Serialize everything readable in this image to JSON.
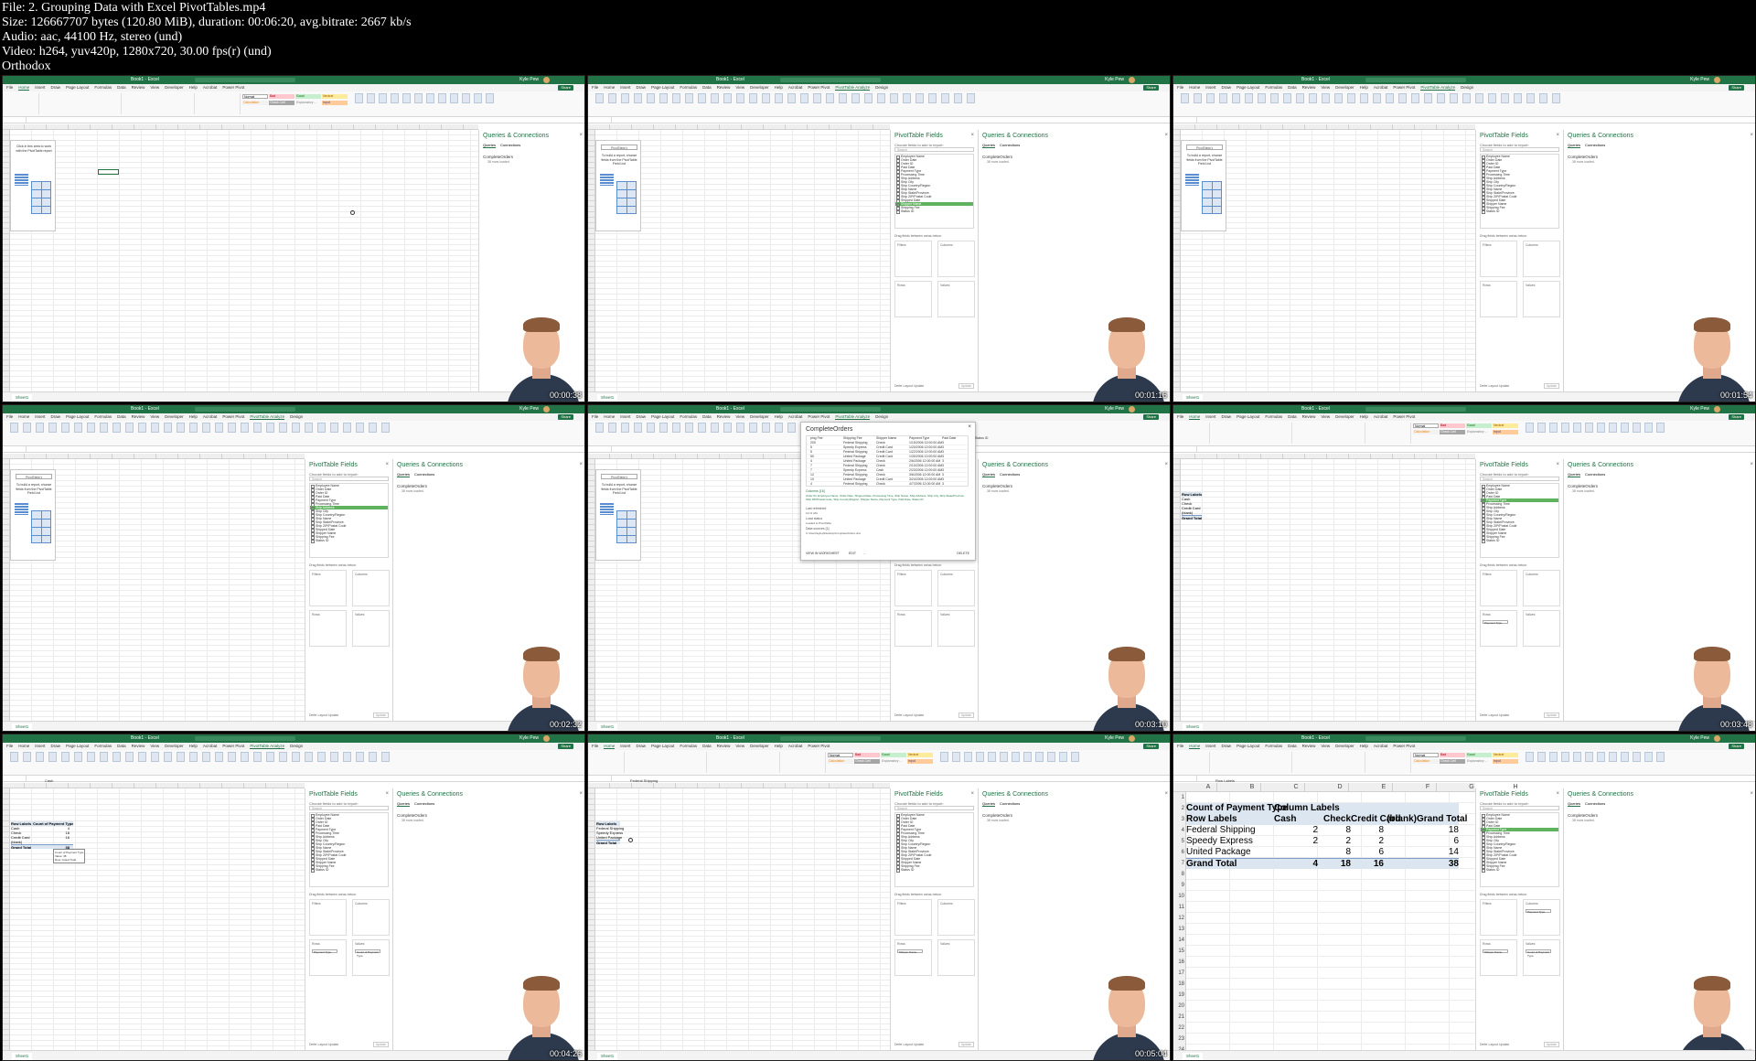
{
  "header": {
    "file": "File: 2. Grouping Data with Excel PivotTables.mp4",
    "size": "Size: 126667707 bytes (120.80 MiB), duration: 00:06:20, avg.bitrate: 2667 kb/s",
    "audio": "Audio: aac, 44100 Hz, stereo (und)",
    "video": "Video: h264, yuv420p, 1280x720, 30.00 fps(r) (und)",
    "brand": "Orthodox"
  },
  "excel": {
    "title": "Book1 - Excel",
    "user": "Kyle Pew",
    "share": "Share",
    "comments": "Comments",
    "sheet": "Sheet1",
    "tabs": [
      "File",
      "Home",
      "Insert",
      "Draw",
      "Page Layout",
      "Formulas",
      "Data",
      "Review",
      "View",
      "Developer",
      "Help",
      "Acrobat",
      "Power Pivot",
      "PivotTable Analyze",
      "Design"
    ],
    "styles": {
      "normal": "Normal",
      "bad": "Bad",
      "good": "Good",
      "neutral": "Neutral",
      "calculation": "Calculation",
      "check": "Check Cell",
      "explanatory": "Explanatory ...",
      "input": "Input"
    },
    "placeholder": {
      "title": "PivotTable1",
      "text": "To build a report, choose fields from the PivotTable Field List"
    },
    "placeholder_first": "Click in this area to work with the PivotTable report",
    "fields_pane": {
      "title": "PivotTable Fields",
      "subtitle": "Choose fields to add to report:",
      "search": "Search",
      "fields": [
        "Employee Name",
        "Order Date",
        "Order ID",
        "Paid Date",
        "Payment Type",
        "Processing Time",
        "Ship Address",
        "Ship City",
        "Ship Country/Region",
        "Ship Name",
        "Ship State/Province",
        "Ship ZIP/Postal Code",
        "Shipped Date",
        "Shipper Name",
        "Shipping Fee",
        "Status ID"
      ],
      "drag_label": "Drag fields between areas below:",
      "filters": "Filters",
      "columns": "Columns",
      "rows": "Rows",
      "values": "Values",
      "defer": "Defer Layout Update",
      "update": "Update"
    },
    "queries_pane": {
      "title": "Queries & Connections",
      "tab_queries": "Queries",
      "tab_connections": "Connections",
      "item": "CompleteOrders",
      "item_sub": "38 rows loaded."
    },
    "dialog": {
      "title": "CompleteOrders",
      "columns": [
        "ping Fee",
        "Shipping Fee",
        "Shipper Name",
        "Payment Type",
        "Paid Date",
        "Status ID"
      ],
      "rows": [
        [
          "200",
          "Federal Shipping",
          "Check",
          "1/15/2006 12:00:00 AM",
          "3"
        ],
        [
          "5",
          "Speedy Express",
          "Credit Card",
          "1/20/2006 12:00:00 AM",
          "3"
        ],
        [
          "5",
          "Federal Shipping",
          "Credit Card",
          "1/22/2006 12:00:00 AM",
          "3"
        ],
        [
          "50",
          "United Package",
          "Credit Card",
          "1/30/2006 12:00:00 AM",
          "3"
        ],
        [
          "4",
          "United Package",
          "Check",
          "2/6/2006 12:00:00 AM",
          "3"
        ],
        [
          "7",
          "Federal Shipping",
          "Check",
          "2/10/2006 12:00:00 AM",
          "3"
        ],
        [
          "7",
          "Speedy Express",
          "Cash",
          "2/23/2006 12:00:00 AM",
          "3"
        ],
        [
          "12",
          "Federal Shipping",
          "Check",
          "3/6/2006 12:00:00 AM",
          "3"
        ],
        [
          "10",
          "United Package",
          "Credit Card",
          "3/24/2006 12:00:00 AM",
          "3"
        ],
        [
          "4",
          "Federal Shipping",
          "Check",
          "4/7/2006 12:00:00 AM",
          "3"
        ]
      ],
      "columns_label": "Columns [16]",
      "columns_text": "Order ID, Employee Name, Order Date, Shipped Date, Processing Time, Ship Name, Ship Address, Ship City, Ship State/Province, Ship ZIP/Postal Code, Ship Country/Region, Shipper Name, Payment Type, Paid Date, Status ID",
      "last_refreshed_label": "Last refreshed",
      "last_refreshed": "12:11 AM",
      "load_status_label": "Load status",
      "load_status": "Loaded to PivotTable",
      "data_sources_label": "Data sources [1]",
      "data_source": "C:\\Users\\kylep\\Desktop\\CompleteOrders.xlsx",
      "view": "VIEW IN WORKSHEET",
      "edit": "EDIT",
      "more": "...",
      "delete": "DELETE"
    },
    "pivot_small": {
      "row_labels": "Row Labels",
      "items": [
        "Cash",
        "Check",
        "Credit Card",
        "(blank)"
      ],
      "grand_total": "Grand Total"
    },
    "pivot_count": {
      "row_labels": "Row Labels",
      "value_header": "Count of Payment Type",
      "items": [
        [
          "Cash",
          "4"
        ],
        [
          "Check",
          "18"
        ],
        [
          "Credit Card",
          "16"
        ],
        [
          "(blank)",
          ""
        ]
      ],
      "grand_total": [
        "Grand Total",
        "38"
      ],
      "tooltip": [
        "Count of Payment Type",
        "Value: 38",
        "Row: Grand Total"
      ],
      "formula": "Cash"
    },
    "pivot_shippers": {
      "row_labels": "Row Labels",
      "items": [
        "Federal Shipping",
        "Speedy Express",
        "United Package"
      ],
      "grand_total": "Grand Total",
      "formula": "Federal Shipping"
    },
    "pivot_final": {
      "formula": "Row Labels",
      "col_letters": [
        "A",
        "B",
        "C",
        "D",
        "E",
        "F",
        "G",
        "H"
      ],
      "row_numbers": [
        "1",
        "2",
        "3",
        "4",
        "5",
        "6",
        "7",
        "8",
        "9",
        "10",
        "11",
        "12",
        "13",
        "14",
        "15",
        "16",
        "17",
        "18",
        "19",
        "20",
        "21",
        "22",
        "23",
        "24",
        "25"
      ],
      "corner": "Count of Payment Type",
      "col_labels": "Column Labels",
      "row_labels": "Row Labels",
      "columns": [
        "Cash",
        "Check",
        "Credit Card",
        "(blank)",
        "Grand Total"
      ],
      "rows": [
        [
          "Federal Shipping",
          "2",
          "8",
          "8",
          "",
          "18"
        ],
        [
          "Speedy Express",
          "2",
          "2",
          "2",
          "",
          "6"
        ],
        [
          "United Package",
          "",
          "8",
          "6",
          "",
          "14"
        ],
        [
          "Grand Total",
          "4",
          "18",
          "16",
          "",
          "38"
        ]
      ],
      "rows_area": "Shipper Name",
      "columns_area": "Payment Type",
      "values_area": "Count of Payment Type"
    }
  },
  "frames": [
    {
      "time": "00:00:38"
    },
    {
      "time": "00:01:16"
    },
    {
      "time": "00:01:54"
    },
    {
      "time": "00:02:32"
    },
    {
      "time": "00:03:10"
    },
    {
      "time": "00:03:48"
    },
    {
      "time": "00:04:26"
    },
    {
      "time": "00:05:04"
    },
    {
      "time": "00:05:42"
    }
  ],
  "colors": {
    "excel_green": "#217346",
    "pivot_header": "#dce6f1",
    "selected_field": "#5fb35f"
  }
}
